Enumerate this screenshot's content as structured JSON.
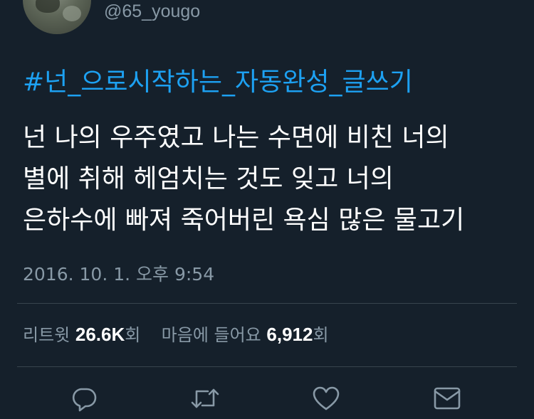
{
  "author": {
    "handle": "@65_yougo"
  },
  "tweet": {
    "hashtag": "#넌_으로시작하는_자동완성_글쓰기",
    "lines": [
      "넌 나의 우주였고 나는 수면에 비친 너의",
      "별에 취해 헤엄치는 것도 잊고 너의",
      "은하수에 빠져 죽어버린 욕심 많은 물고기"
    ],
    "timestamp": "2016. 10. 1. 오후 9:54"
  },
  "stats": {
    "retweets_label": "리트윗",
    "retweets_count": "26.6K",
    "retweets_unit": "회",
    "likes_label": "마음에 들어요",
    "likes_count": "6,912",
    "likes_unit": "회"
  },
  "actions": {
    "reply_icon": "reply-icon",
    "retweet_icon": "retweet-icon",
    "like_icon": "heart-icon",
    "dm_icon": "envelope-icon"
  },
  "colors": {
    "background": "#15202b",
    "link": "#1da1f2",
    "muted": "#8899a6",
    "divider": "#38444d",
    "text": "#ffffff"
  }
}
